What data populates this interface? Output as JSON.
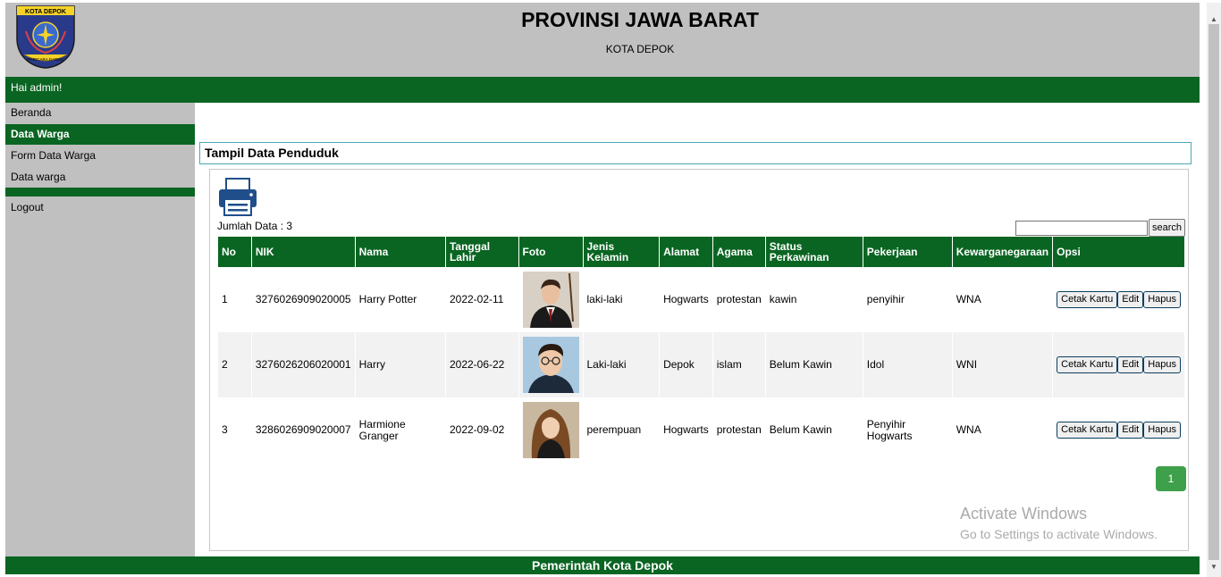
{
  "header": {
    "logo_text": "KOTA DEPOK",
    "logo_motto": "PARICARA DARMA",
    "title": "PROVINSI JAWA BARAT",
    "subtitle": "KOTA DEPOK"
  },
  "greeting": "Hai admin!",
  "sidebar": {
    "items": [
      {
        "label": "Beranda"
      },
      {
        "label": "Data Warga"
      },
      {
        "label": "Form Data Warga"
      },
      {
        "label": "Data warga"
      },
      {
        "label": "Logout"
      }
    ]
  },
  "main": {
    "section_title": "Tampil Data Penduduk",
    "count_label": "Jumlah Data : 3",
    "search_button": "search",
    "search_value": "",
    "columns": [
      "No",
      "NIK",
      "Nama",
      "Tanggal Lahir",
      "Foto",
      "Jenis Kelamin",
      "Alamat",
      "Agama",
      "Status Perkawinan",
      "Pekerjaan",
      "Kewarganegaraan",
      "Opsi"
    ],
    "rows": [
      {
        "no": "1",
        "nik": "3276026909020005",
        "nama": "Harry Potter",
        "tanggal_lahir": "2022-02-11",
        "jenis_kelamin": "laki-laki",
        "alamat": "Hogwarts",
        "agama": "protestan",
        "status": "kawin",
        "pekerjaan": "penyihir",
        "kewarganegaraan": "WNA"
      },
      {
        "no": "2",
        "nik": "3276026206020001",
        "nama": "Harry",
        "tanggal_lahir": "2022-06-22",
        "jenis_kelamin": "Laki-laki",
        "alamat": "Depok",
        "agama": "islam",
        "status": "Belum Kawin",
        "pekerjaan": "Idol",
        "kewarganegaraan": "WNI"
      },
      {
        "no": "3",
        "nik": "3286026909020007",
        "nama": "Harmione Granger",
        "tanggal_lahir": "2022-09-02",
        "jenis_kelamin": "perempuan",
        "alamat": "Hogwarts",
        "agama": "protestan",
        "status": "Belum Kawin",
        "pekerjaan": "Penyihir Hogwarts",
        "kewarganegaraan": "WNA"
      }
    ],
    "actions": {
      "cetak": "Cetak Kartu",
      "edit": "Edit",
      "hapus": "Hapus"
    },
    "page_number": "1"
  },
  "watermark": {
    "line1": "Activate Windows",
    "line2": "Go to Settings to activate Windows."
  },
  "footer": "Pemerintah Kota Depok",
  "colors": {
    "brand_green": "#0a6522",
    "header_gray": "#c0c0c0",
    "pager_green": "#3ea04b"
  }
}
